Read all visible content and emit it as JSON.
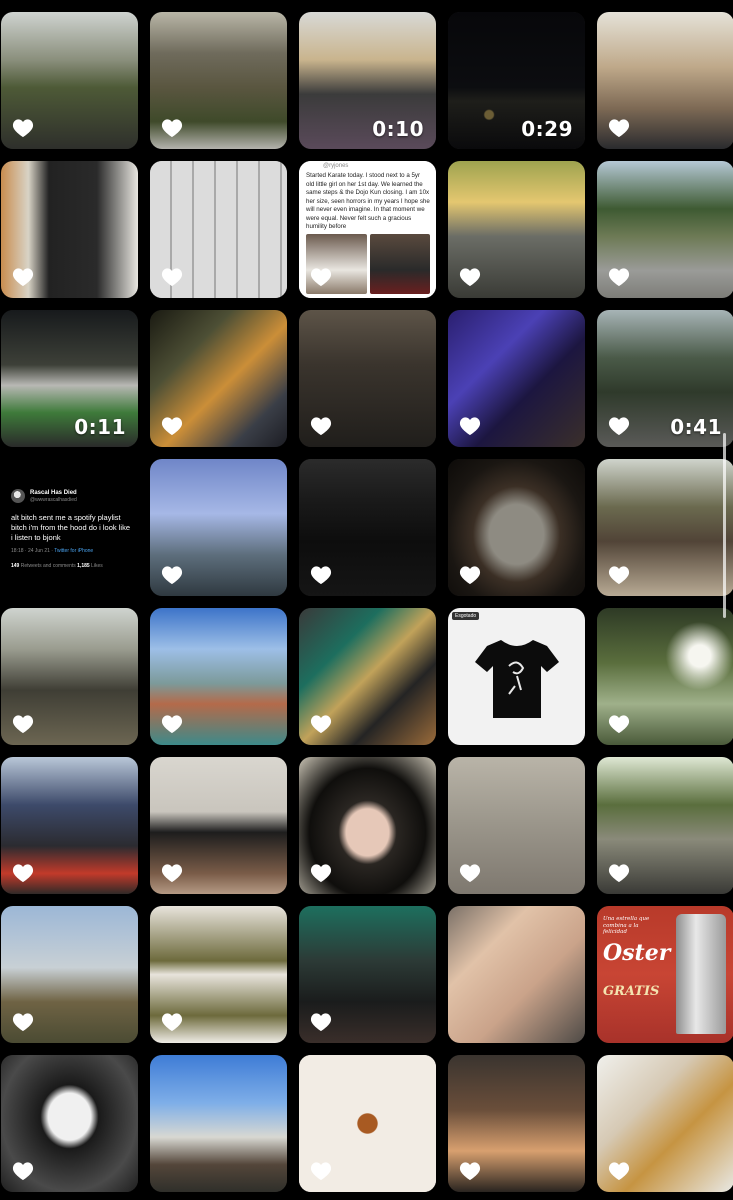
{
  "grid": {
    "tiles": [
      {
        "label": "photo-house-entrance",
        "liked": true,
        "duration": ""
      },
      {
        "label": "photo-abandoned-building",
        "liked": true,
        "duration": ""
      },
      {
        "label": "video-man-yellow-hat",
        "liked": false,
        "duration": "0:10"
      },
      {
        "label": "video-night-city",
        "liked": false,
        "duration": "0:29"
      },
      {
        "label": "photo-man-at-table",
        "liked": true,
        "duration": ""
      },
      {
        "label": "photo-two-men-hallway",
        "liked": true,
        "duration": ""
      },
      {
        "label": "photo-tools-grid",
        "liked": true,
        "duration": ""
      },
      {
        "label": "photo-note-karate",
        "liked": true,
        "duration": ""
      },
      {
        "label": "photo-woman-on-bus",
        "liked": true,
        "duration": ""
      },
      {
        "label": "photo-white-house-driveway",
        "liked": true,
        "duration": ""
      },
      {
        "label": "video-garden-night",
        "liked": false,
        "duration": "0:11"
      },
      {
        "label": "photo-friends-table-night",
        "liked": true,
        "duration": ""
      },
      {
        "label": "photo-group-night",
        "liked": true,
        "duration": ""
      },
      {
        "label": "photo-band-blue-light",
        "liked": true,
        "duration": ""
      },
      {
        "label": "video-cyclist",
        "liked": true,
        "duration": "0:41"
      },
      {
        "label": "tweet-screenshot",
        "liked": false,
        "duration": ""
      },
      {
        "label": "photo-statue-church",
        "liked": true,
        "duration": ""
      },
      {
        "label": "photo-headphones-necklace",
        "liked": true,
        "duration": ""
      },
      {
        "label": "photo-owl",
        "liked": true,
        "duration": ""
      },
      {
        "label": "photo-skaters",
        "liked": true,
        "duration": ""
      },
      {
        "label": "photo-group-street",
        "liked": true,
        "duration": ""
      },
      {
        "label": "photo-basketball-court",
        "liked": true,
        "duration": ""
      },
      {
        "label": "photo-stickers",
        "liked": true,
        "duration": ""
      },
      {
        "label": "photo-black-tshirt",
        "liked": false,
        "duration": ""
      },
      {
        "label": "photo-tree-sunlight",
        "liked": true,
        "duration": ""
      },
      {
        "label": "photo-tv-screen",
        "liked": true,
        "duration": ""
      },
      {
        "label": "photo-swim-cap",
        "liked": true,
        "duration": ""
      },
      {
        "label": "photo-girl-beanie",
        "liked": true,
        "duration": ""
      },
      {
        "label": "photo-dogs-pavement",
        "liked": true,
        "duration": ""
      },
      {
        "label": "photo-man-lying-street",
        "liked": true,
        "duration": ""
      },
      {
        "label": "photo-wood-structure",
        "liked": true,
        "duration": ""
      },
      {
        "label": "photo-group-couch",
        "liked": true,
        "duration": ""
      },
      {
        "label": "photo-man-party",
        "liked": true,
        "duration": ""
      },
      {
        "label": "photo-feet",
        "liked": false,
        "duration": ""
      },
      {
        "label": "photo-oster-ad",
        "liked": false,
        "duration": ""
      },
      {
        "label": "photo-kid-mustache",
        "liked": true,
        "duration": ""
      },
      {
        "label": "photo-street-houses",
        "liked": false,
        "duration": ""
      },
      {
        "label": "photo-tarts",
        "liked": true,
        "duration": ""
      },
      {
        "label": "photo-friends-indoor",
        "liked": true,
        "duration": ""
      },
      {
        "label": "photo-hotdogs",
        "liked": true,
        "duration": ""
      }
    ]
  },
  "tweet": {
    "name": "Rascal Has Died",
    "handle": "@wwwrascalhasdied",
    "body": "alt bitch sent me a spotify playlist bitch i'm from the hood do i look like i listen to bjonk",
    "time": "18:18 · 24 Jun 21 · ",
    "source": "Twitter for iPhone",
    "retweets": "149",
    "retweets_label": " Retweets and comments ",
    "likes": "1,185",
    "likes_label": " Likes"
  },
  "note": {
    "handle": "@ryjones",
    "text": "Started Karate today. I stood next to a 5yr old little girl on her 1st day. We learned the same steps & the Dojo Kun closing. I am 10x her size, seen horrors in my years I hope she will never even imagine. In that moment we were equal. Never felt such a gracious humility before"
  },
  "shirt": {
    "tag": "Esgotado"
  },
  "oster": {
    "brand": "Oster",
    "tagline": "Una estrella que combina a la felicidad",
    "promo": "GRATIS"
  },
  "colors": {
    "background": "#000000",
    "heart": "#ffffff",
    "duration_text": "#ffffff"
  }
}
